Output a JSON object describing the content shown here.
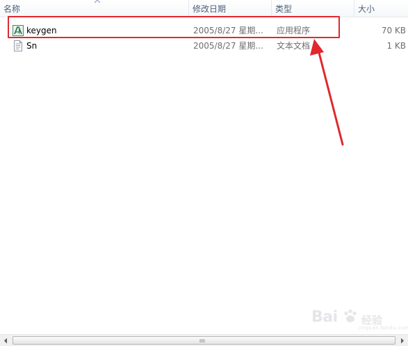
{
  "columns": {
    "name": "名称",
    "date_modified": "修改日期",
    "type": "类型",
    "size": "大小"
  },
  "files": [
    {
      "name": "keygen",
      "date_modified": "2005/8/27 星期...",
      "type": "应用程序",
      "size": "70 KB",
      "icon": "application-icon"
    },
    {
      "name": "Sn",
      "date_modified": "2005/8/27 星期...",
      "type": "文本文档",
      "size": "1 KB",
      "icon": "text-document-icon"
    }
  ],
  "watermark": {
    "text": "Bai",
    "text2": "经验",
    "sub": "jingyan.baidu.com"
  },
  "colors": {
    "annotation": "#e0282d",
    "header_text": "#4c607a",
    "secondary_text": "#6d6d6d"
  }
}
